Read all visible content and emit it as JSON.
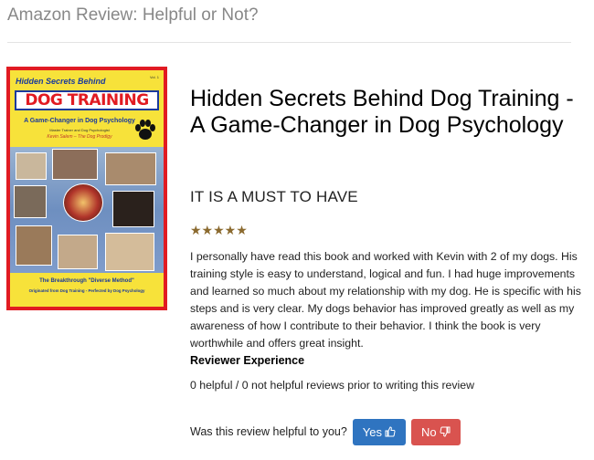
{
  "header": {
    "title": "Amazon Review: Helpful or Not?"
  },
  "book": {
    "title": "Hidden Secrets Behind Dog Training - A Game-Changer in Dog Psychology",
    "cover": {
      "series": "Hidden Secrets Behind",
      "volume": "Vol. 1",
      "title": "DOG TRAINING",
      "subtitle": "A Game-Changer in Dog Psychology",
      "author_line": "Master Trainer and Dog Psychologist",
      "author": "Kevin Salem – The Dog Prodigy",
      "breakthrough": "The Breakthrough \"Diverse Method\"",
      "origin": "Originated from Dog Training - Perfected by Dog Psychology",
      "colors": {
        "border": "#e11b22",
        "background": "#f7e23a",
        "accent": "#1a3a9c"
      }
    }
  },
  "review": {
    "title": "IT IS A MUST TO HAVE",
    "rating": 5,
    "stars": "★★★★★",
    "body": "I personally have read this book and worked with Kevin with 2 of my dogs. His training style is easy to understand, logical and fun. I had huge improvements and learned so much about my relationship with my dog. He is specific with his steps and is very clear. My dogs behavior has improved greatly as well as my awareness of how I contribute to their behavior. I think the book is very worthwhile and offers great insight."
  },
  "reviewer": {
    "heading": "Reviewer Experience",
    "stats": "0 helpful / 0 not helpful reviews prior to writing this review"
  },
  "helpful": {
    "question": "Was this review helpful to you?",
    "yes_label": "Yes",
    "no_label": "No",
    "yes_icon": "thumbs-up-icon",
    "no_icon": "thumbs-down-icon",
    "colors": {
      "yes": "#2f74c0",
      "no": "#d9534f"
    }
  }
}
